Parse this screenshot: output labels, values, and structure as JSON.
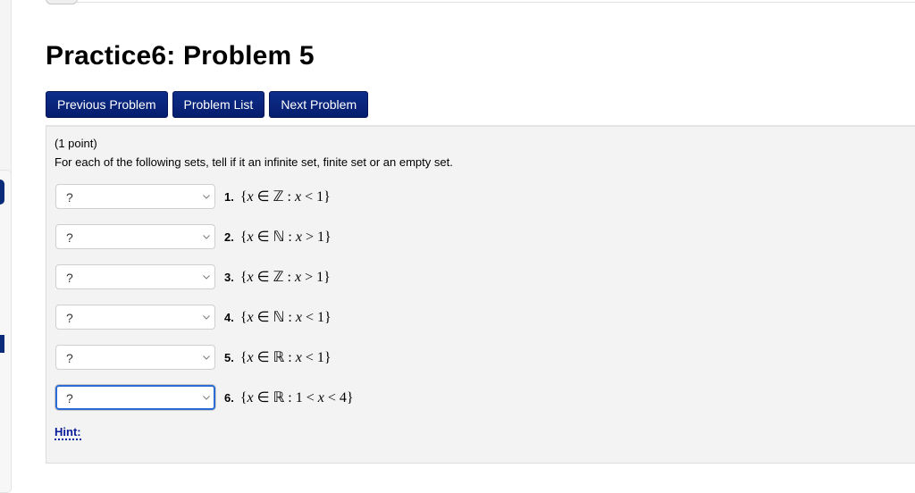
{
  "page": {
    "title": "Practice6: Problem 5"
  },
  "nav": {
    "previous_label": "Previous Problem",
    "list_label": "Problem List",
    "next_label": "Next Problem"
  },
  "problem": {
    "points": "(1 point)",
    "instructions": "For each of the following sets, tell if it an infinite set, finite set or an empty set.",
    "items": [
      {
        "number": "1.",
        "selected": "?",
        "set_open": "{",
        "var": "x",
        "in": " ∈ ",
        "domain": "ℤ",
        "sep": " : ",
        "condition_pre": "",
        "condition_var": "x",
        "condition_post": " < 1",
        "set_close": "}",
        "focused": false
      },
      {
        "number": "2.",
        "selected": "?",
        "set_open": "{",
        "var": "x",
        "in": " ∈ ",
        "domain": "ℕ",
        "sep": " : ",
        "condition_pre": "",
        "condition_var": "x",
        "condition_post": " > 1",
        "set_close": "}",
        "focused": false
      },
      {
        "number": "3.",
        "selected": "?",
        "set_open": "{",
        "var": "x",
        "in": " ∈ ",
        "domain": "ℤ",
        "sep": " : ",
        "condition_pre": "",
        "condition_var": "x",
        "condition_post": " > 1",
        "set_close": "}",
        "focused": false
      },
      {
        "number": "4.",
        "selected": "?",
        "set_open": "{",
        "var": "x",
        "in": " ∈ ",
        "domain": "ℕ",
        "sep": " : ",
        "condition_pre": "",
        "condition_var": "x",
        "condition_post": " < 1",
        "set_close": "}",
        "focused": false
      },
      {
        "number": "5.",
        "selected": "?",
        "set_open": "{",
        "var": "x",
        "in": " ∈ ",
        "domain": "ℝ",
        "sep": " : ",
        "condition_pre": "",
        "condition_var": "x",
        "condition_post": " < 1",
        "set_close": "}",
        "focused": false
      },
      {
        "number": "6.",
        "selected": "?",
        "set_open": "{",
        "var": "x",
        "in": " ∈ ",
        "domain": "ℝ",
        "sep": " : ",
        "condition_pre": "1 < ",
        "condition_var": "x",
        "condition_post": " < 4",
        "set_close": "}",
        "focused": true
      }
    ],
    "hint_label": "Hint:"
  },
  "icons": {
    "dropdown": "chevron-down-icon"
  },
  "colors": {
    "button_bg": "#061d6e",
    "focus_ring": "#2a6bd6",
    "hint_link": "#0a1d9a",
    "problem_bg": "#f3f3f3"
  }
}
